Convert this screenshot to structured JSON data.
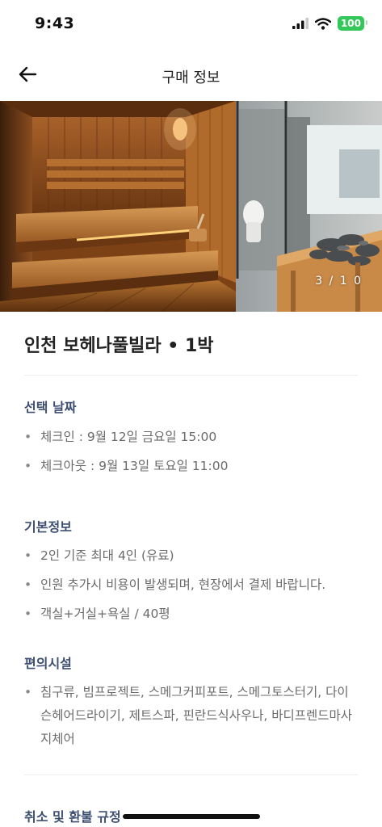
{
  "status": {
    "time": "9:43",
    "battery": "100"
  },
  "nav": {
    "title": "구매 정보",
    "back_icon": "arrow-left-icon"
  },
  "hero": {
    "counter": "3 / 1 0"
  },
  "product": {
    "title": "인천 보헤나풀빌라 • 1박"
  },
  "sections": {
    "date": {
      "title": "선택 날짜",
      "items": [
        "체크인 : 9월 12일 금요일 15:00",
        "체크아웃 : 9월 13일 토요일 11:00"
      ]
    },
    "basic": {
      "title": "기본정보",
      "items": [
        "2인 기준 최대 4인 (유료)",
        "인원 추가시 비용이 발생되며, 현장에서 결제 바랍니다.",
        "객실+거실+욕실 / 40평"
      ]
    },
    "amenities": {
      "title": "편의시설",
      "items": [
        "침구류, 빔프로젝트, 스메그커피포트, 스메그토스터기, 다이슨헤어드라이기, 제트스파, 핀란드식사우나, 바디프렌드마사지체어"
      ]
    },
    "refund": {
      "title": "취소 및 환불 규정"
    }
  },
  "colors": {
    "section_title": "#3e4f72",
    "bullet_text": "#6b6b6b",
    "battery": "#34c759"
  }
}
